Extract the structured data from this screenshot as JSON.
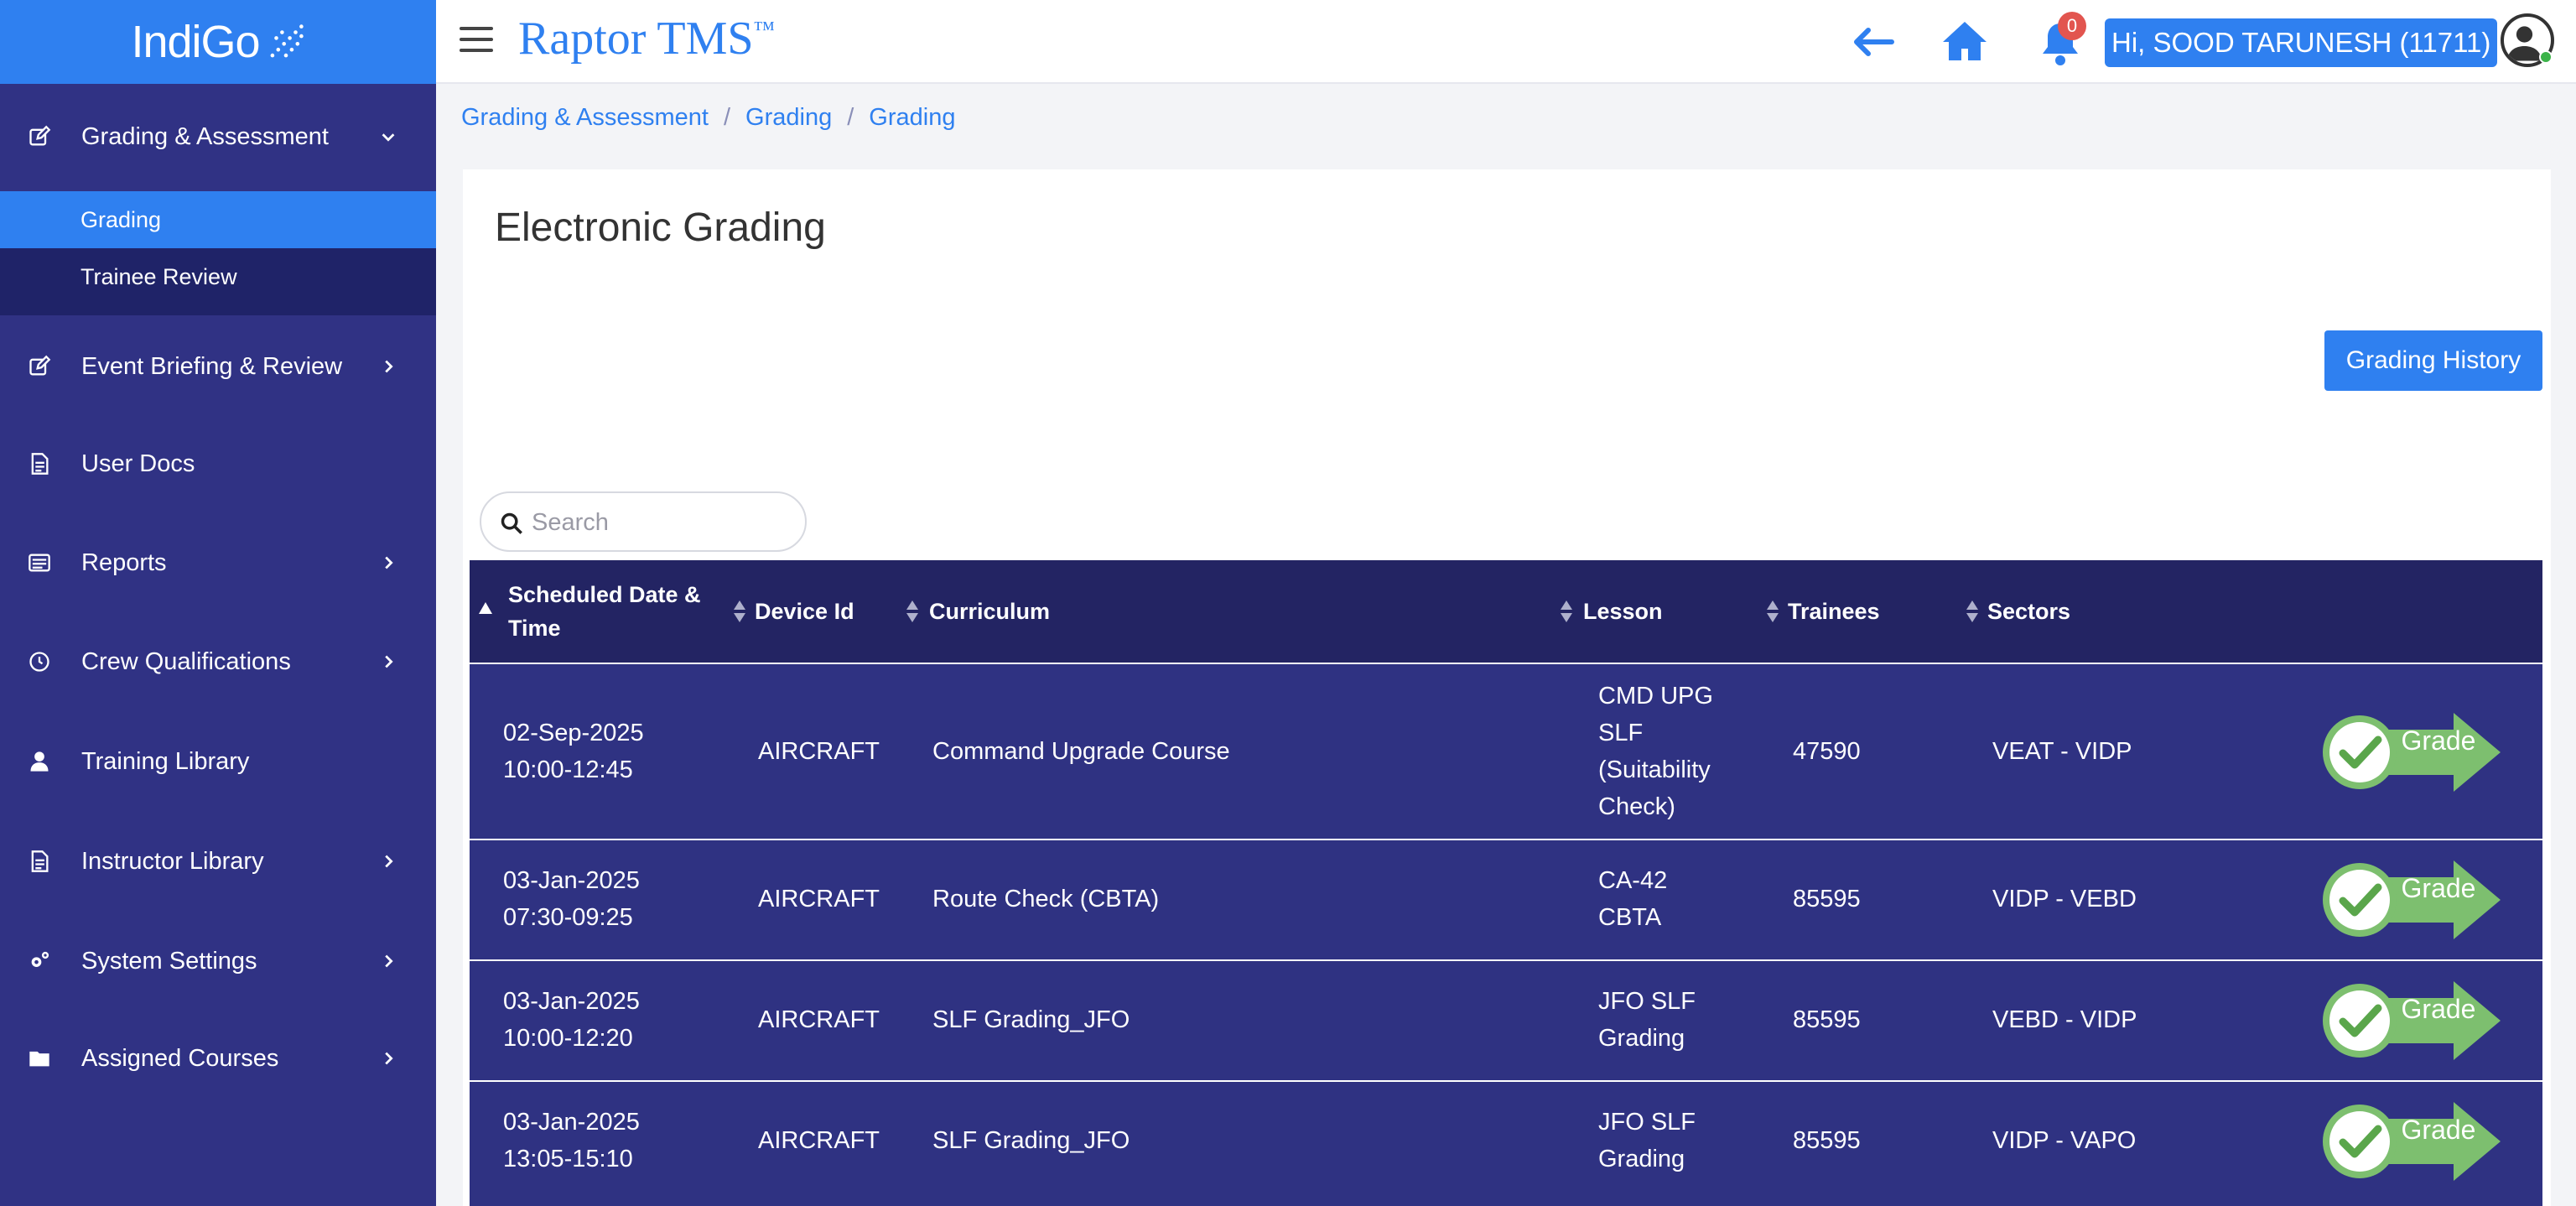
{
  "app": {
    "logo_text": "IndiGo",
    "brand_name": "Raptor TMS",
    "brand_mark": "™",
    "notification_count": "0",
    "user_greeting": "Hi, SOOD TARUNESH (11711)"
  },
  "sidebar": {
    "items": [
      {
        "label": "Grading & Assessment",
        "icon": "edit-icon"
      },
      {
        "label": "Event Briefing & Review",
        "icon": "edit-icon"
      },
      {
        "label": "User Docs",
        "icon": "document-icon"
      },
      {
        "label": "Reports",
        "icon": "report-icon"
      },
      {
        "label": "Crew Qualifications",
        "icon": "clock-icon"
      },
      {
        "label": "Training Library",
        "icon": "user-icon"
      },
      {
        "label": "Instructor Library",
        "icon": "document-icon"
      },
      {
        "label": "System Settings",
        "icon": "gears-icon"
      },
      {
        "label": "Assigned Courses",
        "icon": "folder-icon"
      }
    ],
    "subitems": [
      {
        "label": "Grading",
        "active": true
      },
      {
        "label": "Trainee Review",
        "active": false
      }
    ]
  },
  "breadcrumb": [
    "Grading & Assessment",
    "Grading",
    "Grading"
  ],
  "page": {
    "title": "Electronic Grading",
    "grading_history_label": "Grading History",
    "search_placeholder": "Search"
  },
  "table": {
    "columns": [
      "Scheduled Date & Time",
      "Device Id",
      "Curriculum",
      "Lesson",
      "Trainees",
      "Sectors"
    ],
    "grade_label": "Grade",
    "rows": [
      {
        "date": "02-Sep-2025",
        "time": "10:00-12:45",
        "device": "AIRCRAFT",
        "curriculum": "Command Upgrade Course",
        "lesson": "CMD UPG SLF (Suitability Check)",
        "trainees": "47590",
        "sectors": "VEAT - VIDP"
      },
      {
        "date": "03-Jan-2025",
        "time": "07:30-09:25",
        "device": "AIRCRAFT",
        "curriculum": "Route Check (CBTA)",
        "lesson": "CA-42 CBTA",
        "trainees": "85595",
        "sectors": "VIDP - VEBD"
      },
      {
        "date": "03-Jan-2025",
        "time": "10:00-12:20",
        "device": "AIRCRAFT",
        "curriculum": "SLF Grading_JFO",
        "lesson": "JFO SLF Grading",
        "trainees": "85595",
        "sectors": "VEBD - VIDP"
      },
      {
        "date": "03-Jan-2025",
        "time": "13:05-15:10",
        "device": "AIRCRAFT",
        "curriculum": "SLF Grading_JFO",
        "lesson": "JFO SLF Grading",
        "trainees": "85595",
        "sectors": "VIDP - VAPO"
      }
    ]
  },
  "colors": {
    "accent": "#2f80f0",
    "sidebar_bg": "#303284",
    "table_header": "#232463",
    "table_row": "#2f3282",
    "grade_green": "#7dbf6f"
  }
}
